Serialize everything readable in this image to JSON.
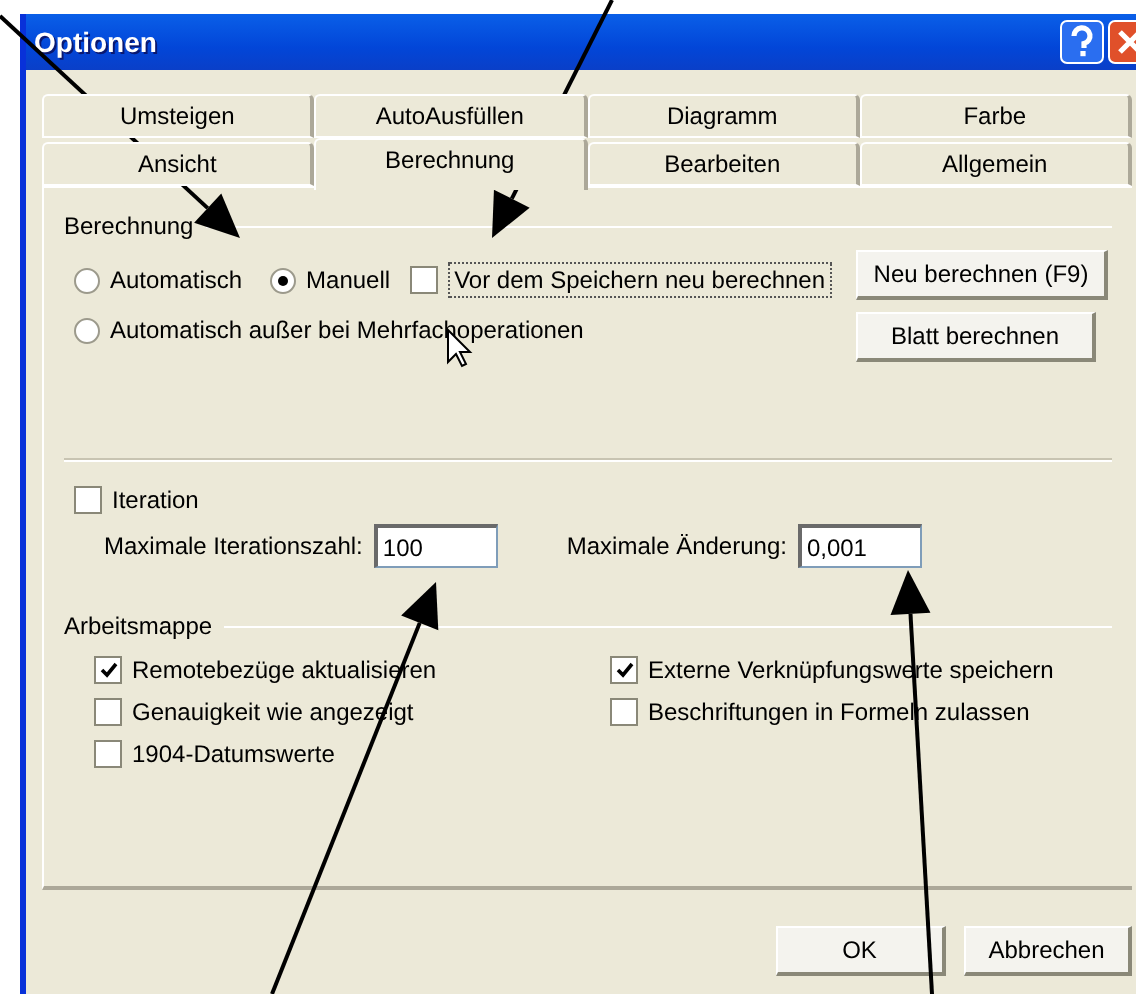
{
  "window": {
    "title": "Optionen"
  },
  "tabs": [
    [
      {
        "label": "Umsteigen",
        "selected": false
      },
      {
        "label": "AutoAusfüllen",
        "selected": false
      },
      {
        "label": "Diagramm",
        "selected": false
      },
      {
        "label": "Farbe",
        "selected": false
      }
    ],
    [
      {
        "label": "Ansicht",
        "selected": false
      },
      {
        "label": "Berechnung",
        "selected": true
      },
      {
        "label": "Bearbeiten",
        "selected": false
      },
      {
        "label": "Allgemein",
        "selected": false
      }
    ]
  ],
  "calculation": {
    "title": "Berechnung",
    "modes": [
      {
        "label": "Automatisch",
        "selected": false
      },
      {
        "label": "Manuell",
        "selected": true
      },
      {
        "label": "Automatisch außer bei Mehrfachoperationen",
        "selected": false
      }
    ],
    "recalc_before_save": {
      "label": "Vor dem Speichern neu berechnen",
      "checked": false
    },
    "buttons": [
      "Neu berechnen (F9)",
      "Blatt berechnen"
    ]
  },
  "iteration": {
    "label": "Iteration",
    "checked": false,
    "fields": [
      {
        "label": "Maximale Iterationszahl:",
        "value": "100"
      },
      {
        "label": "Maximale Änderung:",
        "value": "0,001"
      }
    ]
  },
  "workbook": {
    "title": "Arbeitsmappe",
    "options": [
      {
        "label": "Remotebezüge aktualisieren",
        "checked": true
      },
      {
        "label": "Externe Verknüpfungswerte speichern",
        "checked": true
      },
      {
        "label": "Genauigkeit wie angezeigt",
        "checked": false
      },
      {
        "label": "Beschriftungen in Formeln zulassen",
        "checked": false
      },
      {
        "label": "1904-Datumswerte",
        "checked": false
      }
    ]
  },
  "buttons": [
    "OK",
    "Abbrechen"
  ]
}
